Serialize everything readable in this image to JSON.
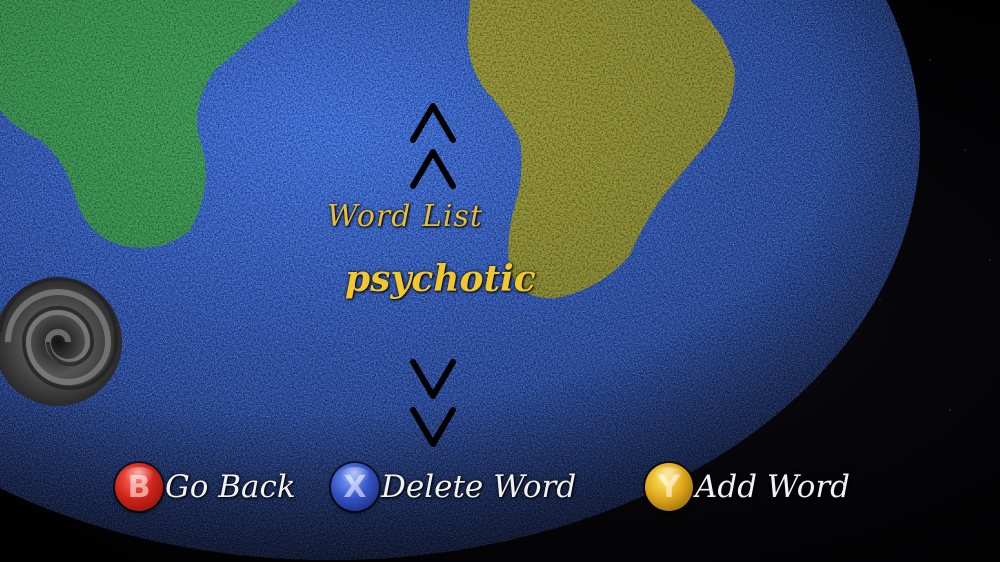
{
  "menu": {
    "title": "Word List",
    "current_word": "psychotic"
  },
  "controls": {
    "back": {
      "button": "B",
      "label": "Go Back"
    },
    "delete": {
      "button": "X",
      "label": "Delete Word"
    },
    "add": {
      "button": "Y",
      "label": "Add Word"
    }
  },
  "icons": {
    "scroll_up": "double-chevron-up-icon",
    "scroll_down": "double-chevron-down-icon",
    "black_hole": "swirl-vortex-icon"
  },
  "colors": {
    "ocean": "#1f4fc4",
    "land_green": "#2f9a4a",
    "land_yellow": "#9a9a2a",
    "text_gold": "#f2c72d",
    "button_b": "#d0241a",
    "button_x": "#3353c4",
    "button_y": "#e0a81a"
  }
}
